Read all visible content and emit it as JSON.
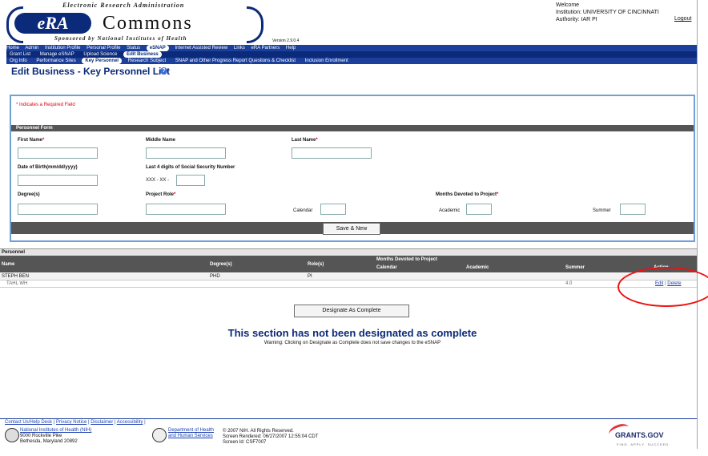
{
  "header": {
    "logo_top": "Electronic Research Administration",
    "logo_era": "eRA",
    "logo_commons": "Commons",
    "logo_sub": "Sponsored by National Institutes of Health",
    "version": "Version 2.9.0.4",
    "welcome": "Welcome",
    "institution": "Institution: UNIVERSITY OF CINCINNATI",
    "authority": "Authority: IAR PI",
    "logout": "Logout"
  },
  "nav": {
    "primary": [
      "Home",
      "Admin",
      "Institution Profile",
      "Personal Profile",
      "Status",
      "eSNAP",
      "Internet Assisted Review",
      "Links",
      "eRA Partners",
      "Help"
    ],
    "active_primary": "eSNAP",
    "secondary": [
      "Grant List",
      "Manage eSNAP",
      "Upload Science",
      "Edit Business"
    ],
    "tertiary": [
      "Org Info",
      "Performance Sites",
      "Key Personnel",
      "Research Subject",
      "SNAP and Other Progress Report Questions & Checklist",
      "Inclusion Enrollment"
    ]
  },
  "page": {
    "title": "Edit Business - Key Personnel List",
    "help_icon": "?"
  },
  "form": {
    "required_note": "* Indicates a Required Field",
    "section_title": "Personnel Form",
    "first_name_label": "First Name",
    "middle_name_label": "Middle Name",
    "last_name_label": "Last Name",
    "dob_label": "Date of Birth(mm/dd/yyyy)",
    "ssn_label": "Last 4 digits of Social Security Number",
    "ssn_prefix": "XXX - XX -",
    "degree_label": "Degree(s)",
    "role_label": "Project Role",
    "months_label": "Months Devoted to Project",
    "calendar_label": "Calendar",
    "academic_label": "Academic",
    "summer_label": "Summer",
    "save_button": "Save & New"
  },
  "personnel": {
    "bar_title": "Personnel",
    "headers": {
      "name": "Name",
      "degrees": "Degree(s)",
      "role": "Role(s)",
      "months": "Months Devoted to Project",
      "calendar": "Calendar",
      "academic": "Academic",
      "summer": "Summer",
      "action": "Action"
    },
    "rows": [
      {
        "name": "STEPH    BEN",
        "degrees": "PHD",
        "role": "PI",
        "calendar": "",
        "academic": "",
        "summer": ""
      },
      {
        "name": "TAHL WH",
        "degrees": "",
        "role": "",
        "calendar": "",
        "academic": "",
        "summer": "4.0",
        "edit": "Edit",
        "sep": " | ",
        "delete": "Delete"
      }
    ]
  },
  "designate_button": "Designate As Complete",
  "status_message": "This section has not been designated as complete",
  "warning": "Warning: Clicking on Designate as Complete does not save changes to the eSNAP",
  "footer": {
    "links": [
      "Contact Us/Help Desk",
      "Privacy Notice",
      "Disclaimer",
      "Accessibility"
    ],
    "nih_line1": "National Institutes of Health (NIH)",
    "nih_line2": "9000 Rockville Pike",
    "nih_line3": "Bethesda, Maryland 20892",
    "hhs_line1": "Department of Health",
    "hhs_line2": "and Human Services",
    "copyright": "© 2007 NIH. All Rights Reserved.",
    "rendered": "Screen Rendered: 06/27/2007 12:55:04 CDT",
    "screen_id": "Screen Id: CSF7007",
    "grants_logo": "GRANTS.GOV",
    "grants_tag": "FIND. APPLY. SUCCEED."
  }
}
